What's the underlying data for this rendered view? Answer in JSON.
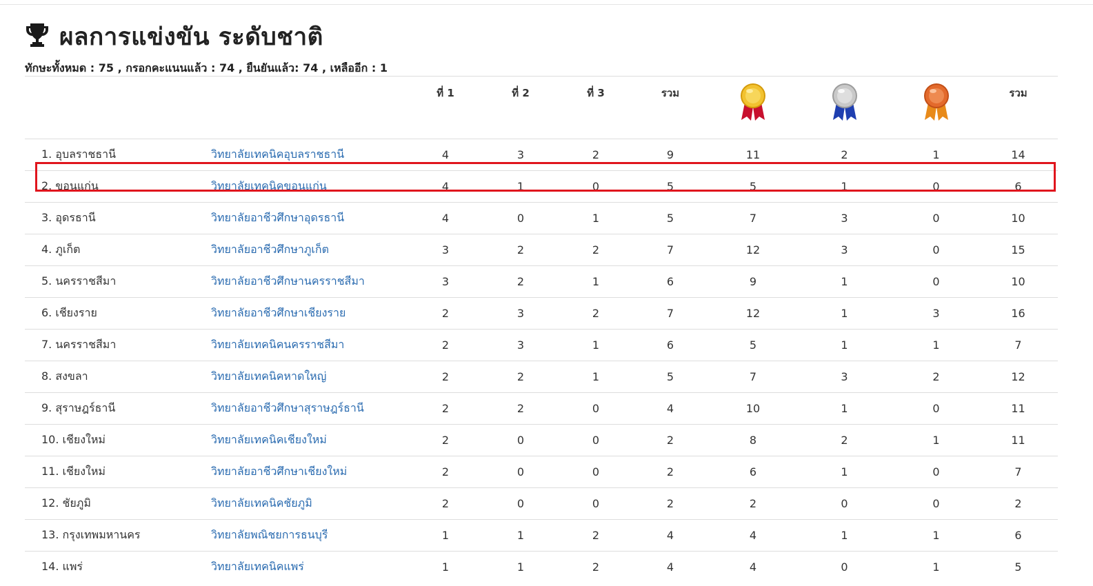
{
  "page": {
    "title": "ผลการแข่งขัน ระดับชาติ",
    "summary": "ทักษะทั้งหมด : 75 , กรอกคะแนนแล้ว : 74 , ยืนยันแล้ว: 74 , เหลืออีก : 1",
    "title_icon": "trophy-icon"
  },
  "table": {
    "headers": {
      "first": "ที่ 1",
      "second": "ที่ 2",
      "third": "ที่ 3",
      "total_rank": "รวม",
      "gold_icon": "gold-medal-icon",
      "silver_icon": "silver-medal-icon",
      "bronze_icon": "bronze-medal-icon",
      "total_medal": "รวม"
    },
    "highlight_row": 1,
    "highlight_color": "#e0151d",
    "link_color": "#2a6bb0",
    "rows": [
      {
        "province": "1. อุบลราชธานี",
        "school": "วิทยาลัยเทคนิคอุบลราชธานี",
        "r1": "4",
        "r2": "3",
        "r3": "2",
        "total": "9",
        "gold": "11",
        "silver": "2",
        "bronze": "1",
        "medals": "14"
      },
      {
        "province": "2. ขอนแก่น",
        "school": "วิทยาลัยเทคนิคขอนแก่น",
        "r1": "4",
        "r2": "1",
        "r3": "0",
        "total": "5",
        "gold": "5",
        "silver": "1",
        "bronze": "0",
        "medals": "6"
      },
      {
        "province": "3. อุดรธานี",
        "school": "วิทยาลัยอาชีวศึกษาอุดรธานี",
        "r1": "4",
        "r2": "0",
        "r3": "1",
        "total": "5",
        "gold": "7",
        "silver": "3",
        "bronze": "0",
        "medals": "10"
      },
      {
        "province": "4. ภูเก็ต",
        "school": "วิทยาลัยอาชีวศึกษาภูเก็ต",
        "r1": "3",
        "r2": "2",
        "r3": "2",
        "total": "7",
        "gold": "12",
        "silver": "3",
        "bronze": "0",
        "medals": "15"
      },
      {
        "province": "5. นครราชสีมา",
        "school": "วิทยาลัยอาชีวศึกษานครราชสีมา",
        "r1": "3",
        "r2": "2",
        "r3": "1",
        "total": "6",
        "gold": "9",
        "silver": "1",
        "bronze": "0",
        "medals": "10"
      },
      {
        "province": "6. เชียงราย",
        "school": "วิทยาลัยอาชีวศึกษาเชียงราย",
        "r1": "2",
        "r2": "3",
        "r3": "2",
        "total": "7",
        "gold": "12",
        "silver": "1",
        "bronze": "3",
        "medals": "16"
      },
      {
        "province": "7. นครราชสีมา",
        "school": "วิทยาลัยเทคนิคนครราชสีมา",
        "r1": "2",
        "r2": "3",
        "r3": "1",
        "total": "6",
        "gold": "5",
        "silver": "1",
        "bronze": "1",
        "medals": "7"
      },
      {
        "province": "8. สงขลา",
        "school": "วิทยาลัยเทคนิคหาดใหญ่",
        "r1": "2",
        "r2": "2",
        "r3": "1",
        "total": "5",
        "gold": "7",
        "silver": "3",
        "bronze": "2",
        "medals": "12"
      },
      {
        "province": "9. สุราษฎร์ธานี",
        "school": "วิทยาลัยอาชีวศึกษาสุราษฎร์ธานี",
        "r1": "2",
        "r2": "2",
        "r3": "0",
        "total": "4",
        "gold": "10",
        "silver": "1",
        "bronze": "0",
        "medals": "11"
      },
      {
        "province": "10. เชียงใหม่",
        "school": "วิทยาลัยเทคนิคเชียงใหม่",
        "r1": "2",
        "r2": "0",
        "r3": "0",
        "total": "2",
        "gold": "8",
        "silver": "2",
        "bronze": "1",
        "medals": "11"
      },
      {
        "province": "11. เชียงใหม่",
        "school": "วิทยาลัยอาชีวศึกษาเชียงใหม่",
        "r1": "2",
        "r2": "0",
        "r3": "0",
        "total": "2",
        "gold": "6",
        "silver": "1",
        "bronze": "0",
        "medals": "7"
      },
      {
        "province": "12. ชัยภูมิ",
        "school": "วิทยาลัยเทคนิคชัยภูมิ",
        "r1": "2",
        "r2": "0",
        "r3": "0",
        "total": "2",
        "gold": "2",
        "silver": "0",
        "bronze": "0",
        "medals": "2"
      },
      {
        "province": "13. กรุงเทพมหานคร",
        "school": "วิทยาลัยพณิชยการธนบุรี",
        "r1": "1",
        "r2": "1",
        "r3": "2",
        "total": "4",
        "gold": "4",
        "silver": "1",
        "bronze": "1",
        "medals": "6"
      },
      {
        "province": "14. แพร่",
        "school": "วิทยาลัยเทคนิคแพร่",
        "r1": "1",
        "r2": "1",
        "r3": "2",
        "total": "4",
        "gold": "4",
        "silver": "0",
        "bronze": "1",
        "medals": "5"
      }
    ]
  }
}
